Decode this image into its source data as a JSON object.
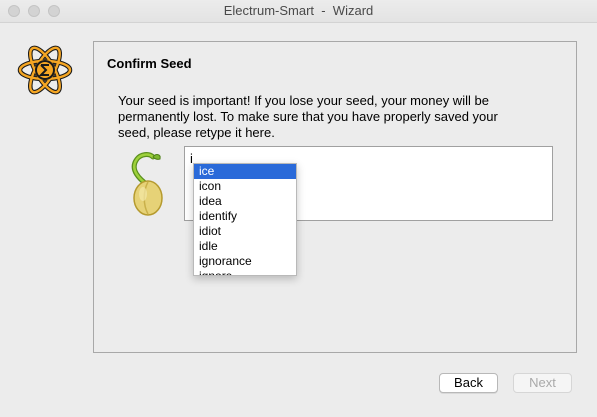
{
  "window": {
    "title": "Electrum-Smart  -  Wizard"
  },
  "panel": {
    "title": "Confirm Seed",
    "message_line1": "Your seed is important! If you lose your seed, your money will be",
    "message_line2": "permanently lost. To make sure that you have properly saved your",
    "message_line3": "seed, please retype it here."
  },
  "seed_input": {
    "value": "i"
  },
  "completer": {
    "items": [
      "ice",
      "icon",
      "idea",
      "identify",
      "idiot",
      "idle",
      "ignorance",
      "ignore"
    ],
    "selected": "ice"
  },
  "buttons": {
    "back_label": "Back",
    "next_label": "Next"
  },
  "colors": {
    "selection": "#2a6ad9",
    "logo_orange": "#f5a623"
  },
  "icons": {
    "logo": "electrum-atom-logo-icon",
    "seed": "sprouting-seed-icon"
  }
}
